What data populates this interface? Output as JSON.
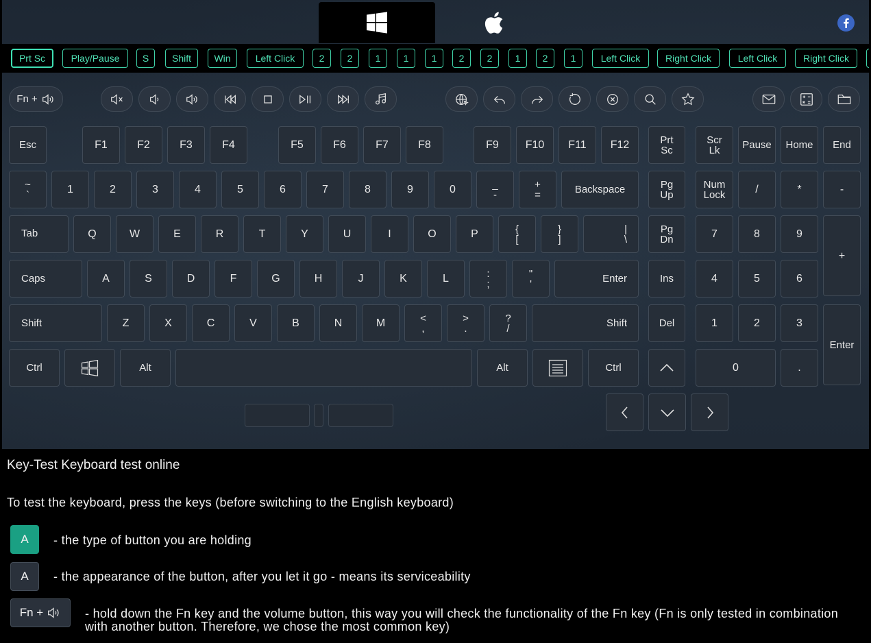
{
  "os_tabs": {
    "windows_icon": "windows-icon",
    "apple_icon": "apple-icon",
    "social_icon": "facebook-icon"
  },
  "history": [
    "Prt Sc",
    "Play/Pause",
    "S",
    "Shift",
    "Win",
    "Left Click",
    "2",
    "2",
    "1",
    "1",
    "1",
    "2",
    "2",
    "1",
    "2",
    "1",
    "Left Click",
    "Right Click",
    "Left Click",
    "Right Click"
  ],
  "fn_key": {
    "label": "Fn +",
    "icon": "volume-icon"
  },
  "media_keys": [
    "mute-icon",
    "volume-down-icon",
    "volume-up-icon",
    "previous-track-icon",
    "stop-icon",
    "play-pause-icon",
    "next-track-icon",
    "music-icon",
    "web-icon",
    "back-icon",
    "forward-icon",
    "refresh-icon",
    "close-icon",
    "search-icon",
    "favorites-icon",
    "mail-icon",
    "calculator-icon",
    "folder-icon"
  ],
  "keys": {
    "esc": "Esc",
    "f1": "F1",
    "f2": "F2",
    "f3": "F3",
    "f4": "F4",
    "f5": "F5",
    "f6": "F6",
    "f7": "F7",
    "f8": "F8",
    "f9": "F9",
    "f10": "F10",
    "f11": "F11",
    "f12": "F12",
    "prtsc_1": "Prt",
    "prtsc_2": "Sc",
    "scrlk_1": "Scr",
    "scrlk_2": "Lk",
    "pause": "Pause",
    "home": "Home",
    "end": "End",
    "tilde_1": "~",
    "tilde_2": "`",
    "d1": "1",
    "d2": "2",
    "d3": "3",
    "d4": "4",
    "d5": "5",
    "d6": "6",
    "d7": "7",
    "d8": "8",
    "d9": "9",
    "d0": "0",
    "minus_1": "_",
    "minus_2": "-",
    "equal_1": "+",
    "equal_2": "=",
    "backspace": "Backspace",
    "pgup_1": "Pg",
    "pgup_2": "Up",
    "numlock_1": "Num",
    "numlock_2": "Lock",
    "np_div": "/",
    "np_mul": "*",
    "np_sub": "-",
    "tab": "Tab",
    "q": "Q",
    "w": "W",
    "e": "E",
    "r": "R",
    "t": "T",
    "y": "Y",
    "u": "U",
    "i": "I",
    "o": "O",
    "p": "P",
    "lbr_1": "{",
    "lbr_2": "[",
    "rbr_1": "}",
    "rbr_2": "]",
    "bsl_1": "|",
    "bsl_2": "\\",
    "pgdn_1": "Pg",
    "pgdn_2": "Dn",
    "np7": "7",
    "np8": "8",
    "np9": "9",
    "np_add": "+",
    "caps": "Caps",
    "a": "A",
    "s": "S",
    "d": "D",
    "f": "F",
    "g": "G",
    "h": "H",
    "j": "J",
    "k": "K",
    "l": "L",
    "semi_1": ":",
    "semi_2": ";",
    "quote_1": "\"",
    "quote_2": "'",
    "enter": "Enter",
    "ins": "Ins",
    "np4": "4",
    "np5": "5",
    "np6": "6",
    "lshift": "Shift",
    "z": "Z",
    "x": "X",
    "c": "C",
    "v": "V",
    "b": "B",
    "n": "N",
    "m": "M",
    "comma_1": "<",
    "comma_2": ",",
    "period_1": ">",
    "period_2": ".",
    "slash_1": "?",
    "slash_2": "/",
    "rshift": "Shift",
    "del": "Del",
    "np1": "1",
    "np2": "2",
    "np3": "3",
    "np_enter": "Enter",
    "lctrl": "Ctrl",
    "lalt": "Alt",
    "ralt": "Alt",
    "rctrl": "Ctrl",
    "np0": "0",
    "np_dot": "."
  },
  "description": {
    "title": "Key-Test Keyboard test online",
    "subtitle": "To test the keyboard, press the keys (before switching to the English keyboard)",
    "legend": [
      {
        "key": "A",
        "text": "- the type of button you are holding",
        "color": "#1aa083"
      },
      {
        "key": "A",
        "text": "- the appearance of the button, after you let it go - means its serviceability",
        "color": "#2a313b"
      },
      {
        "key": "Fn +",
        "text": "- hold down the Fn key and the volume button, this way you will check the functionality of the Fn key (Fn is only tested in combination with another button. Therefore, we chose the most common key)",
        "color": "#2a313b"
      }
    ]
  },
  "colors": {
    "accent": "#3fd1a7",
    "key_bg": "#262e38",
    "pressed": "#1aa083"
  }
}
